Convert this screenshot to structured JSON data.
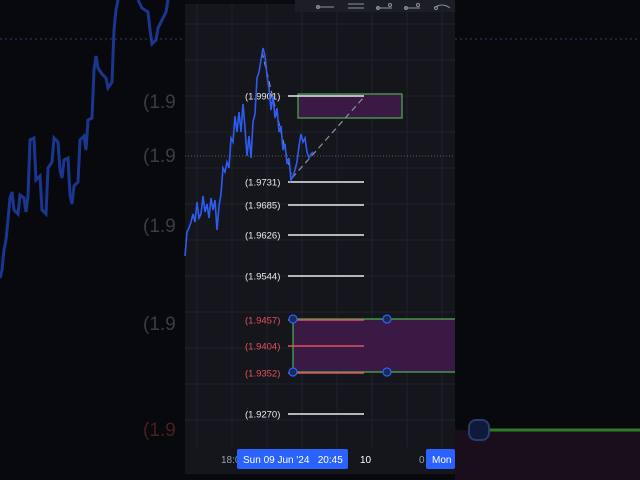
{
  "background_labels": [
    "(1.9",
    "(1.9",
    "(1.9",
    "(1.9"
  ],
  "background_label_red": "(1.9",
  "fib_levels": [
    {
      "label": "(1.9901)",
      "value": 1.9901,
      "tone": "white"
    },
    {
      "label": "(1.9731)",
      "value": 1.9731,
      "tone": "white"
    },
    {
      "label": "(1.9685)",
      "value": 1.9685,
      "tone": "white"
    },
    {
      "label": "(1.9626)",
      "value": 1.9626,
      "tone": "white"
    },
    {
      "label": "(1.9544)",
      "value": 1.9544,
      "tone": "white"
    },
    {
      "label": "(1.9457)",
      "value": 1.9457,
      "tone": "red"
    },
    {
      "label": "(1.9404)",
      "value": 1.9404,
      "tone": "red"
    },
    {
      "label": "(1.9352)",
      "value": 1.9352,
      "tone": "red"
    },
    {
      "label": "(1.9270)",
      "value": 1.927,
      "tone": "white"
    }
  ],
  "time_axis": {
    "tick_left": "18:0",
    "crosshair_label": "Sun 09 Jun '24   20:45",
    "tick_mid": "10",
    "tick_right": "0",
    "next_label": "Mon"
  },
  "colors": {
    "price_line": "#2f5bf0",
    "accent_blue": "#2962ff",
    "zone_green": "#4caf50",
    "zone_fill": "#3a1a45",
    "level_red": "#e2515f",
    "level_white": "#e9eaec"
  },
  "toolbar_icons": [
    "trend-line-icon",
    "horizontal-lines-icon",
    "path-icon",
    "anchored-path-icon",
    "curve-icon"
  ]
}
